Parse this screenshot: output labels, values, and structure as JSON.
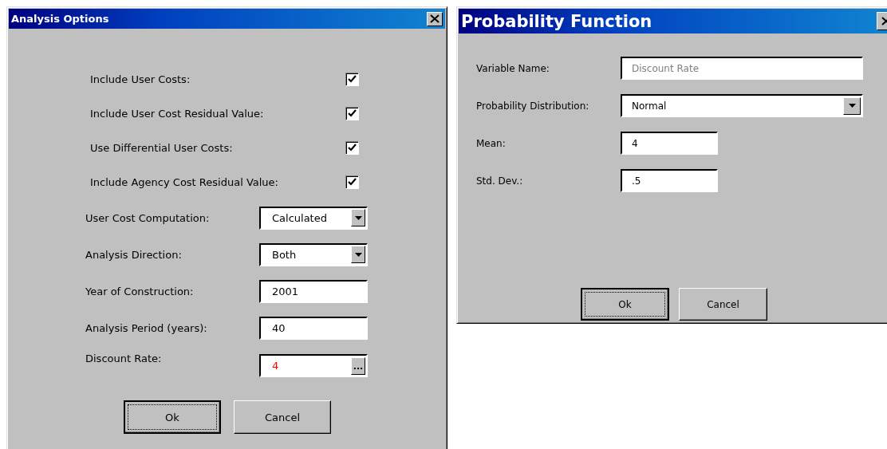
{
  "dialogs": [
    {
      "kind": "analysis",
      "title": "Analysis Options",
      "fields": [
        {
          "kind": "checkbox",
          "label": "Include User Costs:",
          "checked": true
        },
        {
          "kind": "checkbox",
          "label": "Include User Cost Residual Value:",
          "checked": true
        },
        {
          "kind": "checkbox",
          "label": "Use Differential User Costs:",
          "checked": true
        },
        {
          "kind": "checkbox",
          "label": "Include Agency Cost Residual Value:",
          "checked": true
        },
        {
          "kind": "dropdown",
          "label": "User Cost Computation:",
          "value": "Calculated"
        },
        {
          "kind": "dropdown",
          "label": "Analysis Direction:",
          "value": "Both"
        },
        {
          "kind": "text",
          "label": "Year of Construction:",
          "value": "2001"
        },
        {
          "kind": "text",
          "label": "Analysis Period (years):",
          "value": "40"
        },
        {
          "kind": "browse",
          "label": "Discount Rate:",
          "value": "4",
          "color": "#ff0000",
          "button": "..."
        }
      ],
      "buttons": [
        {
          "label": "Ok",
          "default": true
        },
        {
          "label": "Cancel",
          "default": false
        }
      ]
    },
    {
      "kind": "probability",
      "title": "Probability Function",
      "fields": [
        {
          "kind": "text",
          "label": "Variable Name:",
          "value": "Discount Rate",
          "disabled": true
        },
        {
          "kind": "dropdown",
          "label": "Probability Distribution:",
          "value": "Normal"
        },
        {
          "kind": "text",
          "label": "Mean:",
          "value": "4",
          "short": true
        },
        {
          "kind": "text",
          "label": "Std. Dev.:",
          "value": ".5",
          "short": true
        }
      ],
      "buttons": [
        {
          "label": "Ok",
          "default": true
        },
        {
          "label": "Cancel",
          "default": false
        }
      ]
    }
  ]
}
